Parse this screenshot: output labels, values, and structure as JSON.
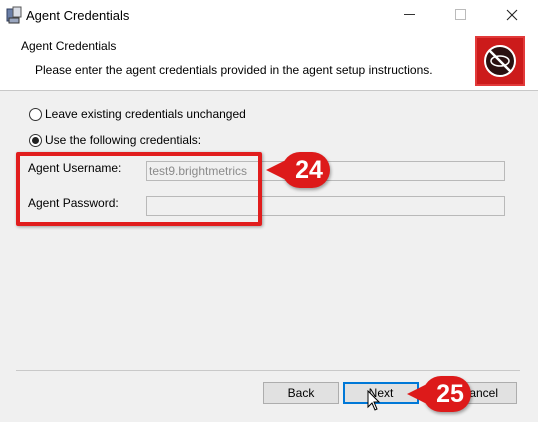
{
  "window": {
    "title": "Agent Credentials"
  },
  "banner": {
    "title": "Agent Credentials",
    "description": "Please enter the agent credentials provided in the agent setup instructions.",
    "icon": "no-entry-logo-icon"
  },
  "options": {
    "leave_label": "Leave existing credentials unchanged",
    "use_label": "Use the following credentials:",
    "selected": "use"
  },
  "fields": {
    "username_label": "Agent Username:",
    "username_value": "test9.brightmetrics",
    "password_label": "Agent Password:",
    "password_value": ""
  },
  "annotations": {
    "step_1": "24",
    "step_2": "25"
  },
  "buttons": {
    "back": "Back",
    "next": "Next",
    "cancel": "ancel"
  },
  "colors": {
    "annotation_red": "#dd1a1a",
    "banner_icon_red": "#cc1b1b",
    "default_button_border": "#0078d7"
  }
}
